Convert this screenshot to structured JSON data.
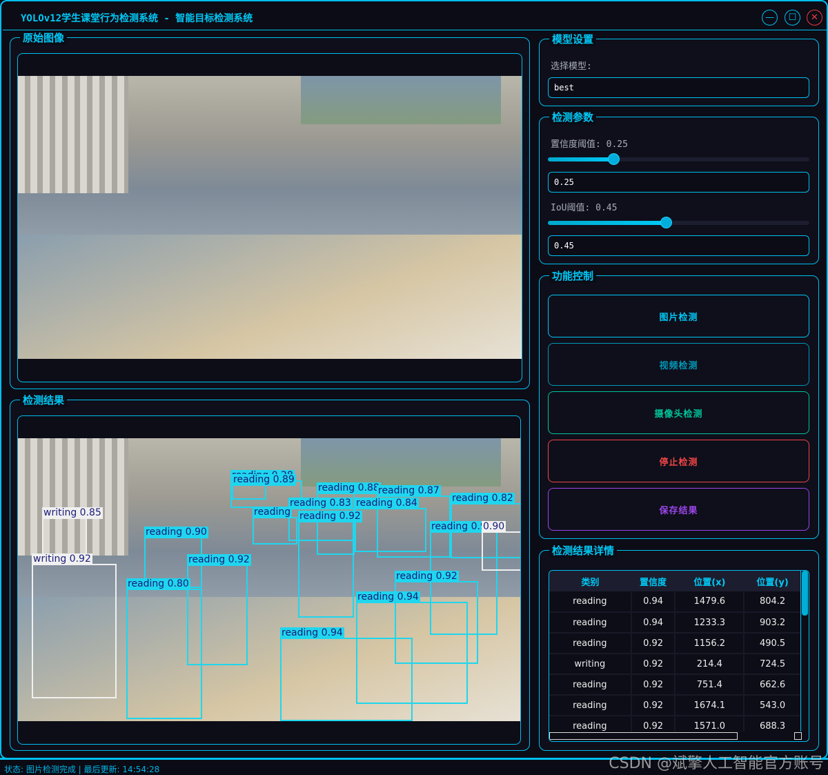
{
  "window": {
    "title": "YOLOv12学生课堂行为检测系统 - 智能目标检测系统",
    "controls": {
      "minimize_icon": "minimize-icon",
      "maximize_icon": "maximize-icon",
      "close_icon": "close-icon"
    }
  },
  "original": {
    "title": "原始图像"
  },
  "result": {
    "title": "检测结果",
    "detections": [
      "writing 0.85",
      "writing 0.92",
      "reading 0.90",
      "reading 0.92",
      "reading 0.80",
      "reading 0.28",
      "reading 0.89",
      "reading 0.88",
      "reading 0.87",
      "reading 0.83",
      "reading 0.84",
      "reading 0.92",
      "reading 0.82",
      "reading 0.92",
      "0.90",
      "reading 0.92",
      "reading 0.94",
      "reading 0.94",
      "reading"
    ]
  },
  "model": {
    "title": "模型设置",
    "label": "选择模型:",
    "value": "best"
  },
  "params": {
    "title": "检测参数",
    "conf_label": "置信度阈值: 0.25",
    "conf_value": "0.25",
    "conf_level": 0.25,
    "iou_label": "IoU阈值: 0.45",
    "iou_value": "0.45",
    "iou_level": 0.45
  },
  "functions": {
    "title": "功能控制",
    "buttons": [
      {
        "label": "图片检测",
        "color": "#00c8f5"
      },
      {
        "label": "视频检测",
        "color": "#0098b8"
      },
      {
        "label": "摄像头检测",
        "color": "#00c49a"
      },
      {
        "label": "停止检测",
        "color": "#f04545"
      },
      {
        "label": "保存结果",
        "color": "#9b45e8"
      }
    ]
  },
  "details": {
    "title": "检测结果详情",
    "columns": [
      "类别",
      "置信度",
      "位置(x)",
      "位置(y)"
    ],
    "rows": [
      [
        "reading",
        "0.94",
        "1479.6",
        "804.2"
      ],
      [
        "reading",
        "0.94",
        "1233.3",
        "903.2"
      ],
      [
        "reading",
        "0.92",
        "1156.2",
        "490.5"
      ],
      [
        "writing",
        "0.92",
        "214.4",
        "724.5"
      ],
      [
        "reading",
        "0.92",
        "751.4",
        "662.6"
      ],
      [
        "reading",
        "0.92",
        "1674.1",
        "543.0"
      ],
      [
        "reading",
        "0.92",
        "1571.0",
        "688.3"
      ]
    ]
  },
  "status": {
    "text": "状态: 图片检测完成 | 最后更新: 14:54:28"
  },
  "watermark": "CSDN @斌擎人工智能官方账号"
}
